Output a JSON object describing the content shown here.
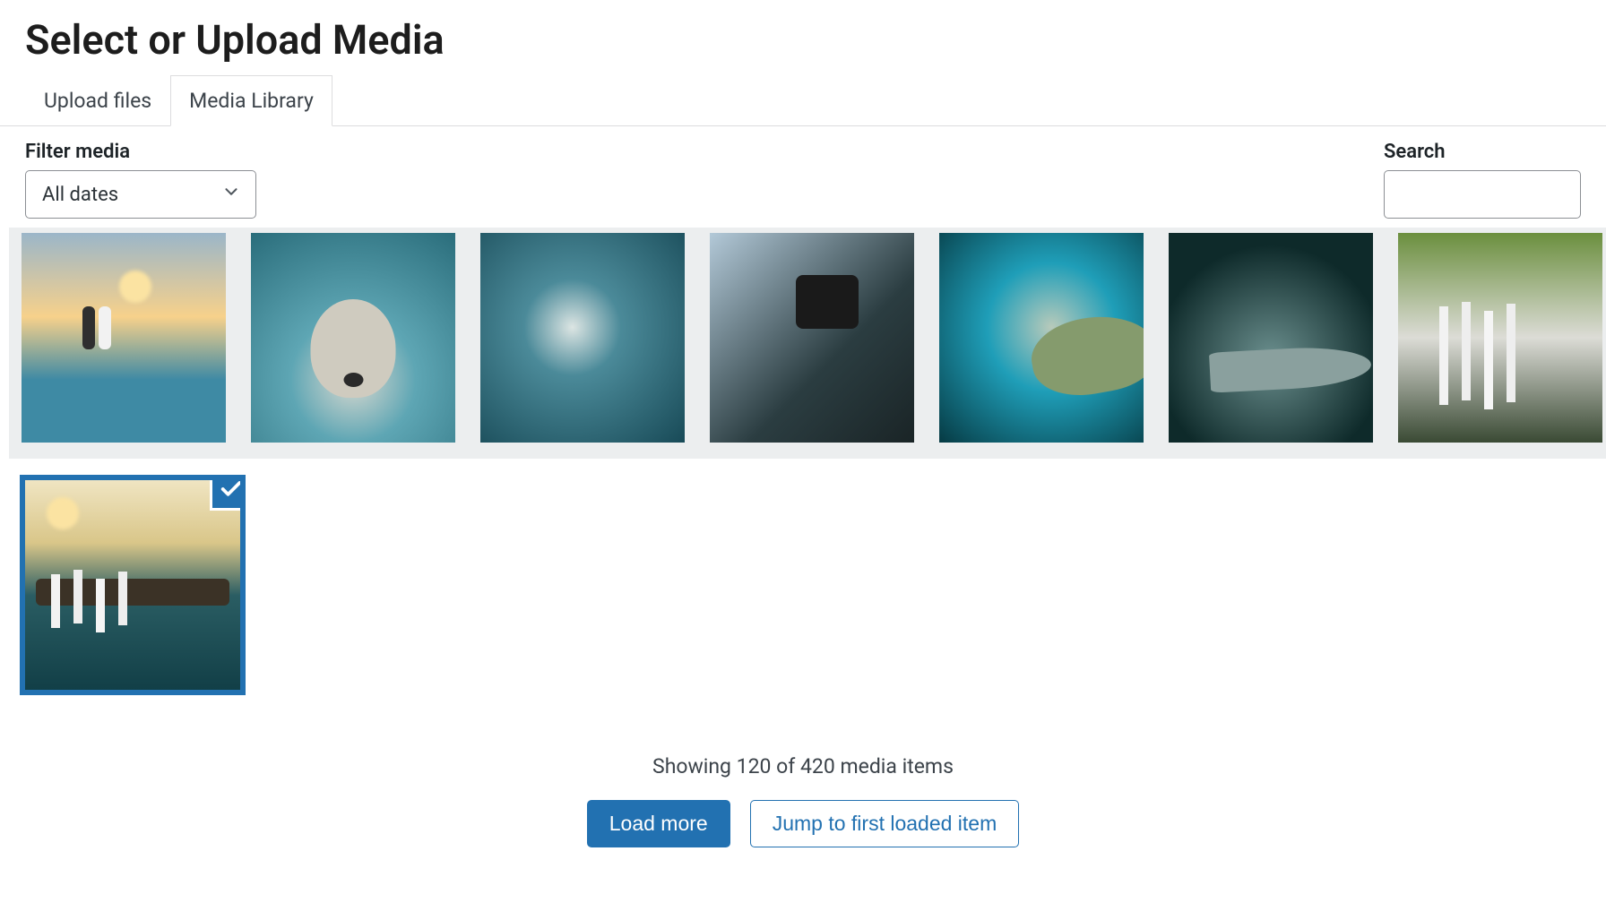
{
  "header": {
    "title": "Select or Upload Media"
  },
  "tabs": {
    "upload": "Upload files",
    "library": "Media Library",
    "active": "library"
  },
  "filter": {
    "label": "Filter media",
    "selected": "All dates"
  },
  "search": {
    "label": "Search",
    "value": ""
  },
  "media": {
    "row1": [
      {
        "name": "beach-couple",
        "class": "ph-beach"
      },
      {
        "name": "seal-underwater",
        "class": "ph-seal"
      },
      {
        "name": "dolphins",
        "class": "ph-dolphin"
      },
      {
        "name": "photographer",
        "class": "ph-camera"
      },
      {
        "name": "sea-turtle",
        "class": "ph-turtle"
      },
      {
        "name": "shark",
        "class": "ph-shark"
      },
      {
        "name": "waterfall-forest",
        "class": "ph-wfall"
      }
    ],
    "row2": [
      {
        "name": "sunset-waterfall",
        "class": "ph-sunfall",
        "selected": true
      }
    ]
  },
  "status": {
    "text": "Showing 120 of 420 media items"
  },
  "actions": {
    "load_more": "Load more",
    "jump_first": "Jump to first loaded item"
  }
}
